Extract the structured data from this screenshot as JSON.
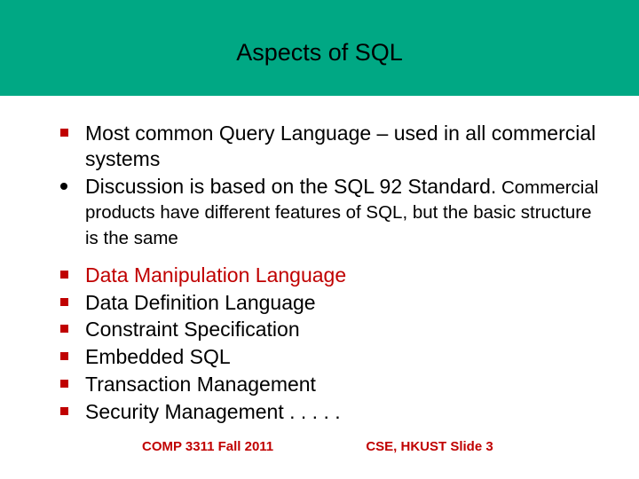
{
  "title": "Aspects of SQL",
  "bullets_group1": [
    {
      "text": "Most common Query Language – used in all commercial systems",
      "marker": "square"
    },
    {
      "text_main": "Discussion is based on the SQL 92 Standard.",
      "text_sub": " Commercial products have different features of SQL, but the basic structure is the same",
      "marker": "dot"
    }
  ],
  "bullets_group2": [
    "Data Manipulation Language",
    "Data Definition Language",
    "Constraint Specification",
    "Embedded SQL",
    "Transaction Management",
    "Security Management . . . . ."
  ],
  "footer_left": "COMP 3311 Fall  2011",
  "footer_right": "CSE, HKUST   Slide 3"
}
